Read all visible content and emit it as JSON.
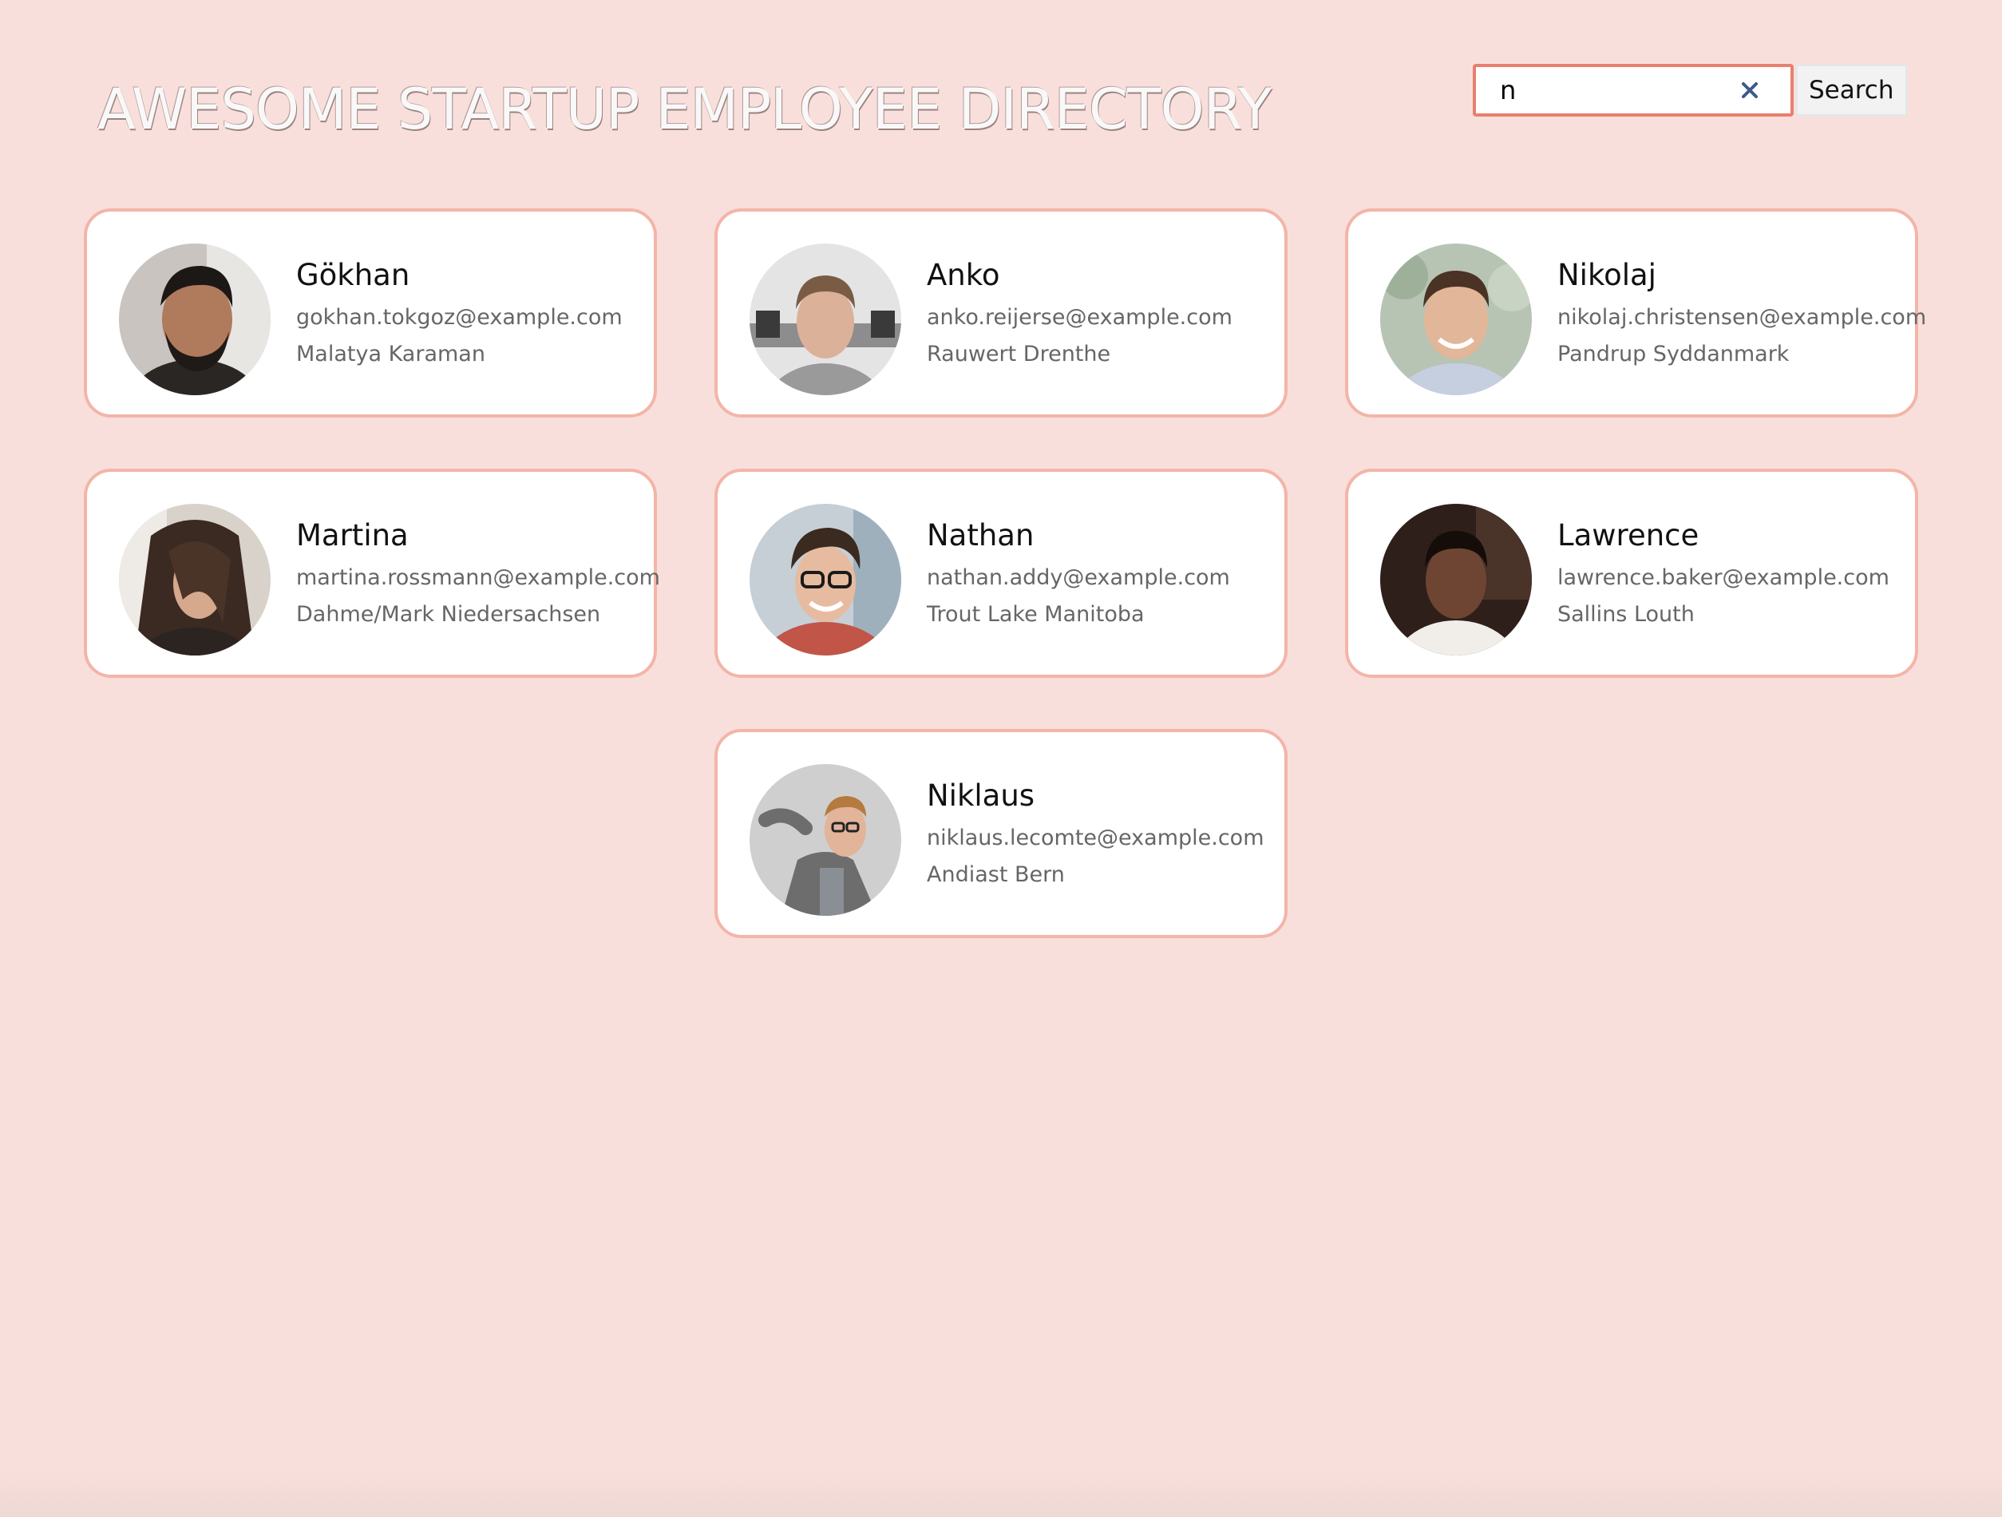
{
  "header": {
    "title": "AWESOME STARTUP EMPLOYEE DIRECTORY"
  },
  "search": {
    "value": "n",
    "placeholder": "",
    "button_label": "Search",
    "clear_icon": "close-icon"
  },
  "colors": {
    "background": "#f9dfdb",
    "card_border": "#f3b5a8",
    "search_border": "#e8806d",
    "clear_icon": "#3d5a8a"
  },
  "employees": [
    {
      "name": "Gökhan",
      "email": "gokhan.tokgoz@example.com",
      "location": "Malatya Karaman",
      "avatar": "avatar-photo"
    },
    {
      "name": "Anko",
      "email": "anko.reijerse@example.com",
      "location": "Rauwert Drenthe",
      "avatar": "avatar-photo"
    },
    {
      "name": "Nikolaj",
      "email": "nikolaj.christensen@example.com",
      "location": "Pandrup Syddanmark",
      "avatar": "avatar-photo"
    },
    {
      "name": "Martina",
      "email": "martina.rossmann@example.com",
      "location": "Dahme/Mark Niedersachsen",
      "avatar": "avatar-photo"
    },
    {
      "name": "Nathan",
      "email": "nathan.addy@example.com",
      "location": "Trout Lake Manitoba",
      "avatar": "avatar-photo"
    },
    {
      "name": "Lawrence",
      "email": "lawrence.baker@example.com",
      "location": "Sallins Louth",
      "avatar": "avatar-photo"
    },
    {
      "name": "Niklaus",
      "email": "niklaus.lecomte@example.com",
      "location": "Andiast Bern",
      "avatar": "avatar-photo"
    }
  ]
}
